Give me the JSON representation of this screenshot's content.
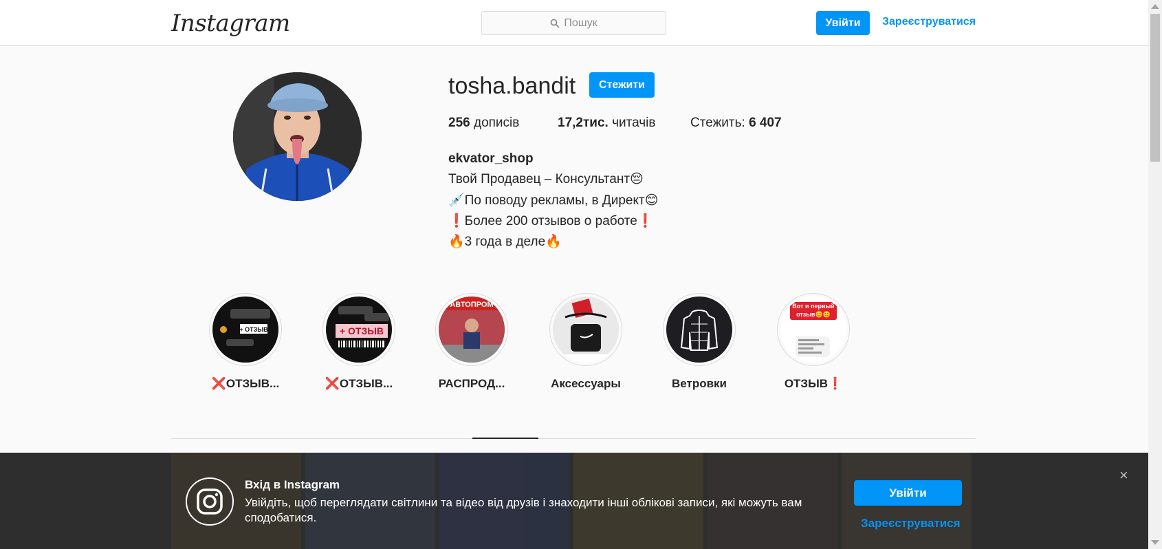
{
  "header": {
    "logo_text": "Instagram",
    "search_placeholder": "Пошук",
    "login_label": "Увійти",
    "register_label": "Зареєструватися"
  },
  "profile": {
    "username": "tosha.bandit",
    "follow_label": "Стежити",
    "stats": {
      "posts_value": "256",
      "posts_label": "дописів",
      "followers_value": "17,2тис.",
      "followers_label": "читачів",
      "following_label": "Стежить:",
      "following_value": "6 407"
    },
    "bio": {
      "name": "ekvator_shop",
      "lines": [
        "Твой Продавец – Консультант😔",
        "💉По поводу рекламы, в Директ😊",
        "❗Более 200 отзывов о работе❗",
        "🔥3 года в деле🔥"
      ]
    }
  },
  "highlights": [
    {
      "label": "❌ОТЗЫВ...",
      "icon": "review-screenshot"
    },
    {
      "label": "❌ОТЗЫВ...",
      "icon": "review-screenshot"
    },
    {
      "label": "РАСПРОД...",
      "icon": "sale-photo"
    },
    {
      "label": "Аксессуары",
      "icon": "bag-photo"
    },
    {
      "label": "Ветровки",
      "icon": "jacket-icon"
    },
    {
      "label": "ОТЗЫВ❗",
      "icon": "review-screenshot"
    }
  ],
  "highlight_art": {
    "h1_text": "+ ОТЗЫВ",
    "h2_text": "+ ОТЗЫВ",
    "h3_text": "АВТОПРОМ",
    "h6_text": "Вот и первый отзыв😊😊"
  },
  "banner": {
    "title": "Вхід в Instagram",
    "text": "Увійдіть, щоб переглядати світлини та відео від друзів і знаходити інші облікові записи, які можуть вам сподобатися.",
    "login_label": "Увійти",
    "register_label": "Зареєструватися",
    "close_symbol": "×"
  },
  "colors": {
    "accent": "#0095f6",
    "banner_bg": "#2e2e2e"
  }
}
